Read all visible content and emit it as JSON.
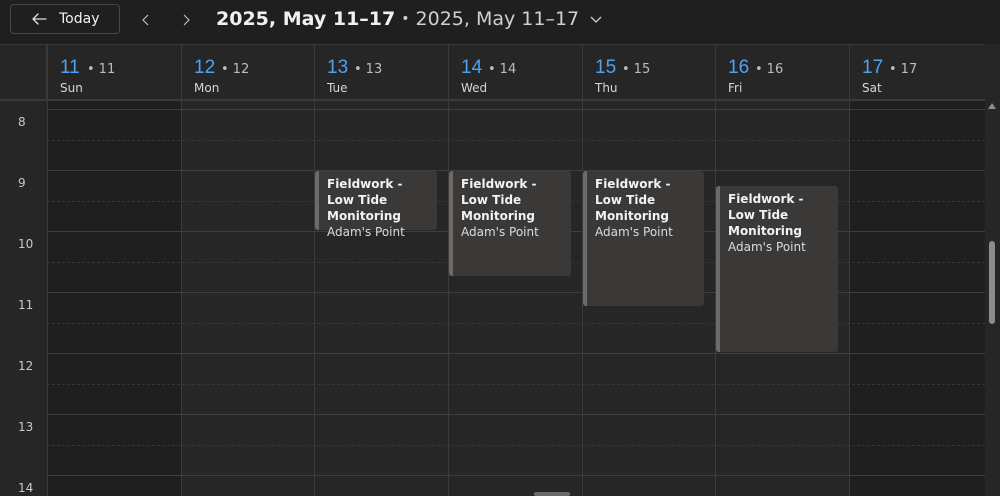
{
  "toolbar": {
    "today_label": "Today",
    "range_title": "2025, May 11–17",
    "range_separator": "•",
    "range_alt": "2025, May 11–17"
  },
  "days": [
    {
      "num": "11",
      "alt": "11",
      "name": "Sun"
    },
    {
      "num": "12",
      "alt": "12",
      "name": "Mon"
    },
    {
      "num": "13",
      "alt": "13",
      "name": "Tue"
    },
    {
      "num": "14",
      "alt": "14",
      "name": "Wed"
    },
    {
      "num": "15",
      "alt": "15",
      "name": "Thu"
    },
    {
      "num": "16",
      "alt": "16",
      "name": "Fri"
    },
    {
      "num": "17",
      "alt": "17",
      "name": "Sat"
    }
  ],
  "hours": [
    "8",
    "9",
    "10",
    "11",
    "12",
    "13",
    "14"
  ],
  "events": [
    {
      "day": "13",
      "title": "Fieldwork - Low Tide Monitoring",
      "location": "Adam's Point",
      "start": "9:00",
      "end": "10:00"
    },
    {
      "day": "14",
      "title": "Fieldwork - Low Tide Monitoring",
      "location": "Adam's Point",
      "start": "9:00",
      "end": "10:45"
    },
    {
      "day": "15",
      "title": "Fieldwork - Low Tide Monitoring",
      "location": "Adam's Point",
      "start": "9:00",
      "end": "11:15"
    },
    {
      "day": "16",
      "title": "Fieldwork - Low Tide Monitoring",
      "location": "Adam's Point",
      "start": "9:15",
      "end": "12:00"
    }
  ],
  "colors": {
    "accent": "#4da3f0",
    "background": "#262626",
    "weekend_background": "#1f1f1f",
    "event_background": "#3b3938"
  }
}
